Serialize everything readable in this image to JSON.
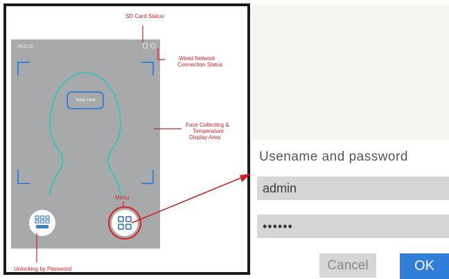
{
  "device_screen": {
    "time": "09:22:30",
    "temp_zone_label": "Temp zone"
  },
  "annotations": {
    "sd_card": "SD Card Status",
    "wired_network_line1": "Wired Network",
    "wired_network_line2": "Connection Status",
    "face_area_line1": "Face Collecting &",
    "face_area_line2": "Temperature",
    "face_area_line3": "Display Area",
    "menu": "Menu",
    "unlocking": "Unlocking by Password"
  },
  "login_dialog": {
    "title": "Usename and password",
    "username_value": "admin",
    "password_value": "••••••",
    "cancel_label": "Cancel",
    "ok_label": "OK"
  },
  "colors": {
    "annotation": "#d42020",
    "face_outline": "#29c5c0",
    "bracket": "#3f7fd0",
    "screen_bg": "#a7a9ab",
    "ok_button": "#2f7ed8"
  }
}
